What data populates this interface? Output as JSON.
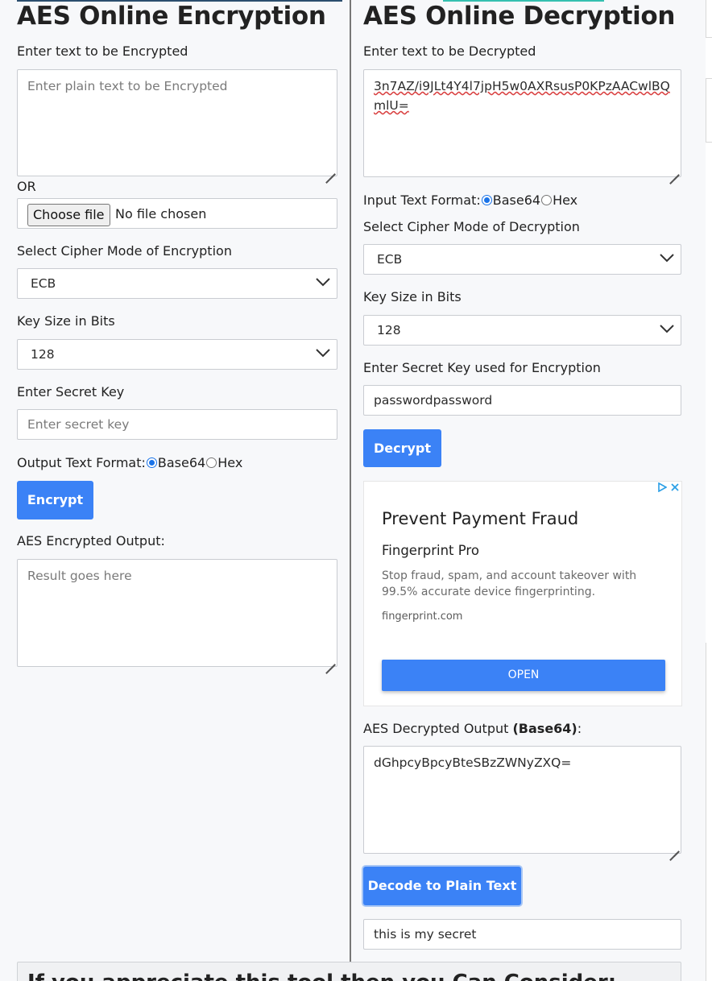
{
  "encryption": {
    "title": "AES Online Encryption",
    "input_label": "Enter text to be Encrypted",
    "input_placeholder": "Enter plain text to be Encrypted",
    "or_label": "OR",
    "file_button": "Choose file",
    "file_status": "No file chosen",
    "mode_label": "Select Cipher Mode of Encryption",
    "mode_value": "ECB",
    "key_size_label": "Key Size in Bits",
    "key_size_value": "128",
    "secret_label": "Enter Secret Key",
    "secret_placeholder": "Enter secret key",
    "format_label": "Output Text Format:",
    "format_options": [
      "Base64",
      "Hex"
    ],
    "format_selected": "Base64",
    "encrypt_button": "Encrypt",
    "output_label": "AES Encrypted Output:",
    "output_placeholder": "Result goes here"
  },
  "decryption": {
    "title": "AES Online Decryption",
    "input_label": "Enter text to be Decrypted",
    "input_value": "3n7AZ/i9JLt4Y4l7jpH5w0AXRsusP0KPzAACwlBQmlU=",
    "format_label": "Input Text Format:",
    "format_options": [
      "Base64",
      "Hex"
    ],
    "format_selected": "Base64",
    "mode_label": "Select Cipher Mode of Decryption",
    "mode_value": "ECB",
    "key_size_label": "Key Size in Bits",
    "key_size_value": "128",
    "secret_label": "Enter Secret Key used for Encryption",
    "secret_value": "passwordpassword",
    "decrypt_button": "Decrypt",
    "output_label_prefix": "AES Decrypted Output ",
    "output_label_format": "(Base64)",
    "output_label_suffix": ":",
    "output_value": "dGhpcyBpcyBteSBzZWNyZXQ=",
    "decode_button": "Decode to Plain Text",
    "plain_text_value": "this is my secret"
  },
  "ad": {
    "headline": "Prevent Payment Fraud",
    "brand": "Fingerprint Pro",
    "description": "Stop fraud, spam, and account takeover with 99.5% accurate device fingerprinting.",
    "url": "fingerprint.com",
    "cta": "OPEN"
  },
  "footer": {
    "heading": "If you appreciate this tool then you Can Consider:"
  },
  "colors": {
    "primary_button": "#3b82f6",
    "page_background": "#f7f8fa"
  }
}
